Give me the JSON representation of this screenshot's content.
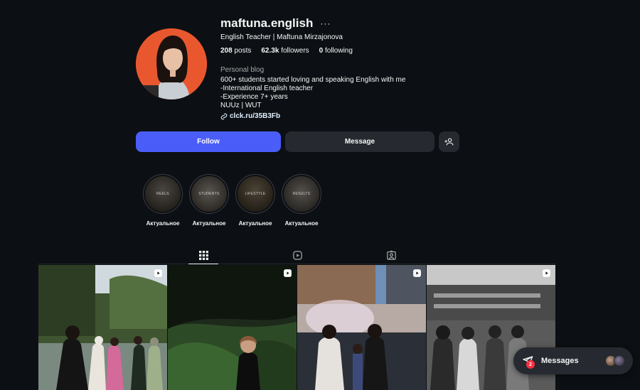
{
  "profile": {
    "username": "maftuna.english",
    "more": "···",
    "full_name": "English Teacher | Maftuna Mirzajonova",
    "posts_count": "208",
    "posts_label": "posts",
    "followers_count": "62.3k",
    "followers_label": "followers",
    "following_count": "0",
    "following_label": "following",
    "category": "Personal blog",
    "bio": [
      "600+ students started loving and speaking English with me",
      "-International English teacher",
      "-Experience 7+ years",
      "NUUz | WUT"
    ],
    "link": "clck.ru/35B3Fb"
  },
  "actions": {
    "follow": "Follow",
    "message": "Message",
    "suggest_icon": "add-person-icon"
  },
  "highlights": [
    {
      "cover_text": "REELS",
      "label": "Актуальное"
    },
    {
      "cover_text": "STUDENTS",
      "label": "Актуальное"
    },
    {
      "cover_text": "LIFESTYLE",
      "label": "Актуальное"
    },
    {
      "cover_text": "RESULTS",
      "label": "Актуальное"
    }
  ],
  "tabs": [
    {
      "icon": "grid-icon",
      "active": true
    },
    {
      "icon": "reels-icon",
      "active": false
    },
    {
      "icon": "tagged-icon",
      "active": false
    }
  ],
  "posts": [
    {
      "type": "reel",
      "icon": "reel-icon"
    },
    {
      "type": "reel",
      "icon": "reel-icon"
    },
    {
      "type": "reel",
      "icon": "reel-icon"
    },
    {
      "type": "reel",
      "icon": "reel-icon"
    }
  ],
  "messages": {
    "label": "Messages",
    "badge": "2",
    "icon": "direct-message-icon"
  },
  "colors": {
    "background": "#0c1014",
    "follow_button": "#4a5df9",
    "secondary_button": "#262a30",
    "link": "#e0f1ff",
    "badge": "#ff3040"
  }
}
